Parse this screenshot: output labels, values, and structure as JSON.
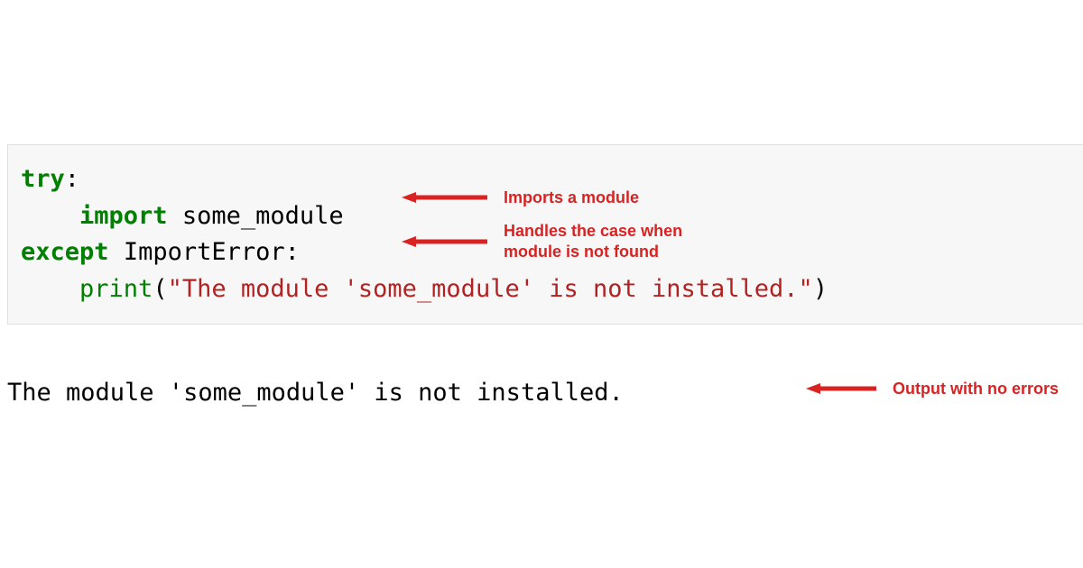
{
  "code": {
    "line1": {
      "kw": "try",
      "colon": ":"
    },
    "line2": {
      "indent": "    ",
      "kw": "import",
      "space": " ",
      "mod": "some_module"
    },
    "line3": {
      "kw": "except",
      "space": " ",
      "exc": "ImportError",
      "colon": ":"
    },
    "line4": {
      "indent": "    ",
      "fn": "print",
      "paren_open": "(",
      "str": "\"The module 'some_module' is not installed.\"",
      "paren_close": ")"
    }
  },
  "output": "The module 'some_module' is not installed.",
  "annotations": {
    "a1": "Imports a module",
    "a2": "Handles the case when\nmodule is not found",
    "a3": "Output with no errors"
  }
}
